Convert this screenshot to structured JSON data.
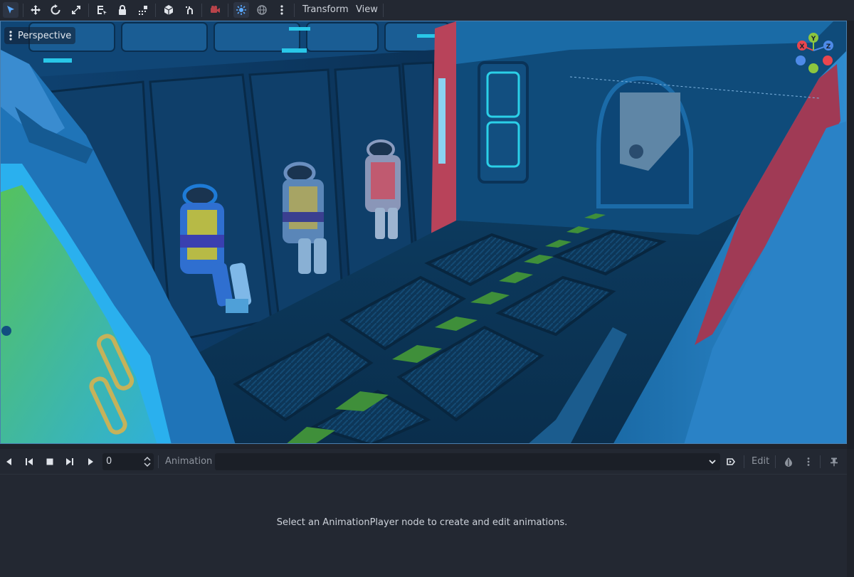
{
  "toolbar": {
    "tools": [
      {
        "icon": "select-pointer-icon"
      },
      {
        "icon": "move-icon"
      },
      {
        "icon": "rotate-icon"
      },
      {
        "icon": "scale-icon"
      },
      {
        "icon": "list-select-icon"
      },
      {
        "icon": "lock-icon"
      },
      {
        "icon": "group-icon"
      },
      {
        "icon": "local-space-icon"
      },
      {
        "icon": "snap-icon"
      },
      {
        "icon": "camera-icon"
      },
      {
        "icon": "sun-preview-icon"
      },
      {
        "icon": "environment-preview-icon"
      },
      {
        "icon": "more-options-icon"
      }
    ],
    "menus": {
      "transform": "Transform",
      "view": "View"
    },
    "accent_color": "#5aa9ff"
  },
  "viewport": {
    "mode_label": "Perspective",
    "gizmo": {
      "x_label": "X",
      "y_label": "Y",
      "z_label": "Z",
      "x_color": "#e8464e",
      "y_color": "#8cc63f",
      "z_color": "#4e8ae8"
    }
  },
  "animation": {
    "controls": [
      {
        "icon": "play-backwards-from-end-icon"
      },
      {
        "icon": "play-backwards-icon"
      },
      {
        "icon": "stop-icon"
      },
      {
        "icon": "play-from-start-icon"
      },
      {
        "icon": "play-icon"
      }
    ],
    "frame_value": "0",
    "label": "Animation",
    "selected_animation": "",
    "edit_label": "Edit",
    "empty_message": "Select an AnimationPlayer node to create and edit animations."
  }
}
